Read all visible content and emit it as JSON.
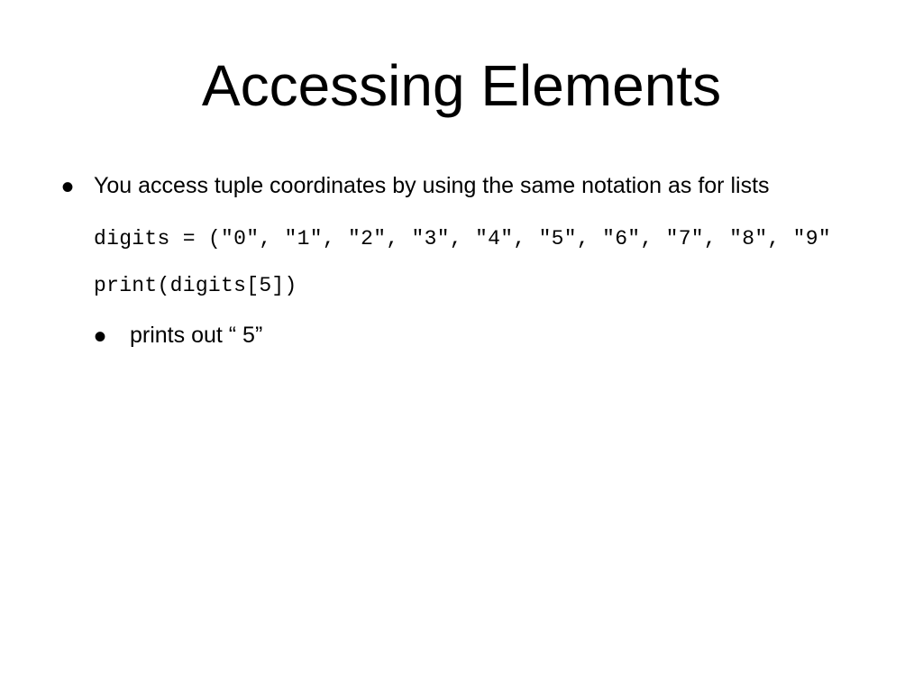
{
  "title": "Accessing Elements",
  "bullets": {
    "main": "You access tuple coordinates by using the same notation as for lists",
    "sub": "prints out “ 5”"
  },
  "code": {
    "line1": "digits = (\"0\", \"1\", \"2\", \"3\", \"4\", \"5\", \"6\", \"7\", \"8\", \"9\"",
    "line2": "print(digits[5])"
  }
}
